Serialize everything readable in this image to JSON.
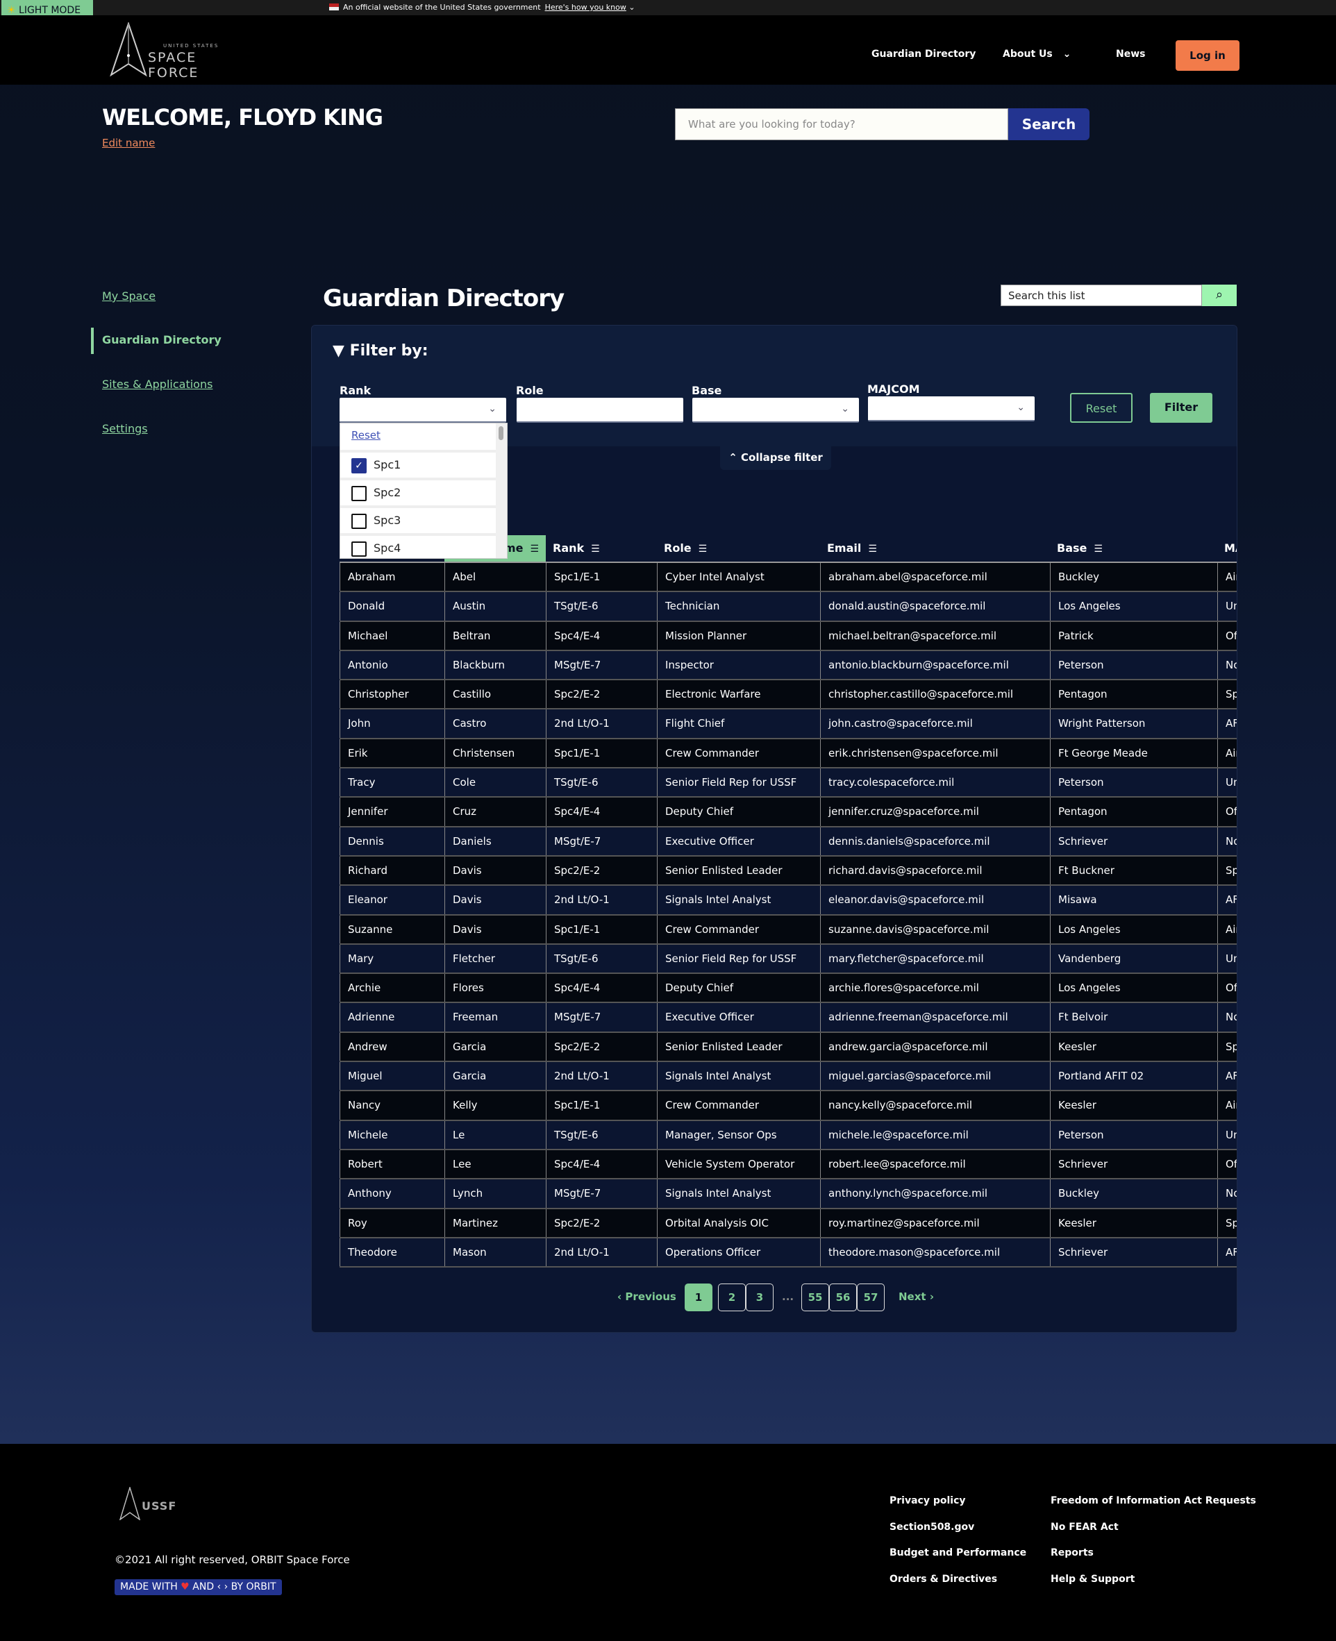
{
  "gov_banner": {
    "text": "An official website of the United States government",
    "link": "Here's how you know"
  },
  "light_mode": "LIGHT MODE",
  "header": {
    "logo_top": "UNITED STATES",
    "logo_main": "SPACE FORCE",
    "nav": [
      "Guardian Directory",
      "About Us",
      "News"
    ],
    "login": "Log in"
  },
  "welcome": {
    "title": "WELCOME, FLOYD KING",
    "edit": "Edit name"
  },
  "search": {
    "placeholder": "What are you looking for today?",
    "button": "Search"
  },
  "sidebar": {
    "items": [
      {
        "label": "My Space"
      },
      {
        "label": "Guardian Directory",
        "active": true
      },
      {
        "label": "Sites & Applications"
      },
      {
        "label": "Settings"
      }
    ]
  },
  "page_title": "Guardian Directory",
  "list_search": {
    "placeholder": "Search this list"
  },
  "filter": {
    "title": "Filter by:",
    "labels": [
      "Rank",
      "Role",
      "Base",
      "MAJCOM"
    ],
    "reset": "Reset",
    "apply": "Filter",
    "collapse": "Collapse filter",
    "rank_dropdown": {
      "reset": "Reset",
      "options": [
        {
          "label": "Spc1",
          "checked": true
        },
        {
          "label": "Spc2",
          "checked": false
        },
        {
          "label": "Spc3",
          "checked": false
        },
        {
          "label": "Spc4",
          "checked": false
        }
      ]
    }
  },
  "table": {
    "headers": [
      "",
      "Last Name",
      "Rank",
      "Role",
      "Email",
      "Base",
      "MA"
    ],
    "rows": [
      [
        "Abraham",
        "Abel",
        "Spc1/E-1",
        "Cyber Intel Analyst",
        "abraham.abel@spaceforce.mil",
        "Buckley",
        "Air"
      ],
      [
        "Donald",
        "Austin",
        "TSgt/E-6",
        "Technician",
        "donald.austin@spaceforce.mil",
        "Los Angeles",
        "Un"
      ],
      [
        "Michael",
        "Beltran",
        "Spc4/E-4",
        "Mission Planner",
        "michael.beltran@spaceforce.mil",
        "Patrick",
        "Off"
      ],
      [
        "Antonio",
        "Blackburn",
        "MSgt/E-7",
        "Inspector",
        "antonio.blackburn@spaceforce.mil",
        "Peterson",
        "No"
      ],
      [
        "Christopher",
        "Castillo",
        "Spc2/E-2",
        "Electronic Warfare",
        "christopher.castillo@spaceforce.mil",
        "Pentagon",
        "Spa"
      ],
      [
        "John",
        "Castro",
        "2nd Lt/O-1",
        "Flight Chief",
        "john.castro@spaceforce.mil",
        "Wright Patterson",
        "AFI"
      ],
      [
        "Erik",
        "Christensen",
        "Spc1/E-1",
        "Crew Commander",
        "erik.christensen@spaceforce.mil",
        "Ft George Meade",
        "Air"
      ],
      [
        "Tracy",
        "Cole",
        "TSgt/E-6",
        "Senior Field Rep for USSF",
        "tracy.colespaceforce.mil",
        "Peterson",
        "Un"
      ],
      [
        "Jennifer",
        "Cruz",
        "Spc4/E-4",
        "Deputy Chief",
        "jennifer.cruz@spaceforce.mil",
        "Pentagon",
        "Off"
      ],
      [
        "Dennis",
        "Daniels",
        "MSgt/E-7",
        "Executive Officer",
        "dennis.daniels@spaceforce.mil",
        "Schriever",
        "No"
      ],
      [
        "Richard",
        "Davis",
        "Spc2/E-2",
        "Senior Enlisted Leader",
        "richard.davis@spaceforce.mil",
        "Ft Buckner",
        "Spa"
      ],
      [
        "Eleanor",
        "Davis",
        "2nd Lt/O-1",
        "Signals Intel Analyst",
        "eleanor.davis@spaceforce.mil",
        "Misawa",
        "AFI"
      ],
      [
        "Suzanne",
        "Davis",
        "Spc1/E-1",
        "Crew Commander",
        "suzanne.davis@spaceforce.mil",
        "Los Angeles",
        "Air"
      ],
      [
        "Mary",
        "Fletcher",
        "TSgt/E-6",
        "Senior Field Rep for USSF",
        "mary.fletcher@spaceforce.mil",
        "Vandenberg",
        "Un"
      ],
      [
        "Archie",
        "Flores",
        "Spc4/E-4",
        "Deputy Chief",
        "archie.flores@spaceforce.mil",
        "Los Angeles",
        "Off"
      ],
      [
        "Adrienne",
        "Freeman",
        "MSgt/E-7",
        "Executive Officer",
        "adrienne.freeman@spaceforce.mil",
        "Ft Belvoir",
        "No"
      ],
      [
        "Andrew",
        "Garcia",
        "Spc2/E-2",
        "Senior Enlisted Leader",
        "andrew.garcia@spaceforce.mil",
        "Keesler",
        "Spa"
      ],
      [
        "Miguel",
        "Garcia",
        "2nd Lt/O-1",
        "Signals Intel Analyst",
        "miguel.garcias@spaceforce.mil",
        "Portland AFIT 02",
        "AFI"
      ],
      [
        "Nancy",
        "Kelly",
        "Spc1/E-1",
        "Crew Commander",
        "nancy.kelly@spaceforce.mil",
        "Keesler",
        "Air"
      ],
      [
        "Michele",
        "Le",
        "TSgt/E-6",
        "Manager, Sensor Ops",
        "michele.le@spaceforce.mil",
        "Peterson",
        "Un"
      ],
      [
        "Robert",
        "Lee",
        "Spc4/E-4",
        "Vehicle System Operator",
        "robert.lee@spaceforce.mil",
        "Schriever",
        "Off"
      ],
      [
        "Anthony",
        "Lynch",
        "MSgt/E-7",
        "Signals Intel Analyst",
        "anthony.lynch@spaceforce.mil",
        "Buckley",
        "No"
      ],
      [
        "Roy",
        "Martinez",
        "Spc2/E-2",
        "Orbital Analysis OIC",
        "roy.martinez@spaceforce.mil",
        "Keesler",
        "Spa"
      ],
      [
        "Theodore",
        "Mason",
        "2nd Lt/O-1",
        "Operations Officer",
        "theodore.mason@spaceforce.mil",
        "Schriever",
        "AFI"
      ]
    ]
  },
  "pagination": {
    "previous": "Previous",
    "next": "Next",
    "pages": [
      "1",
      "2",
      "3",
      "55",
      "56",
      "57"
    ],
    "ellipsis": "...",
    "current": "1"
  },
  "footer": {
    "logo": "USSF",
    "copyright": "©2021 All right reserved, ORBIT Space Force",
    "made_with": {
      "a": "MADE WITH",
      "b": "AND",
      "c": "BY ORBIT"
    },
    "links": [
      "Privacy policy",
      "Section508.gov",
      "Budget and Performance",
      "Orders & Directives",
      "Freedom of Information Act Requests",
      "No FEAR Act",
      "Reports",
      "Help & Support"
    ]
  },
  "colors": {
    "accent_green": "#7fcb93",
    "login_orange": "#f27b4a",
    "brand_blue": "#233490"
  }
}
